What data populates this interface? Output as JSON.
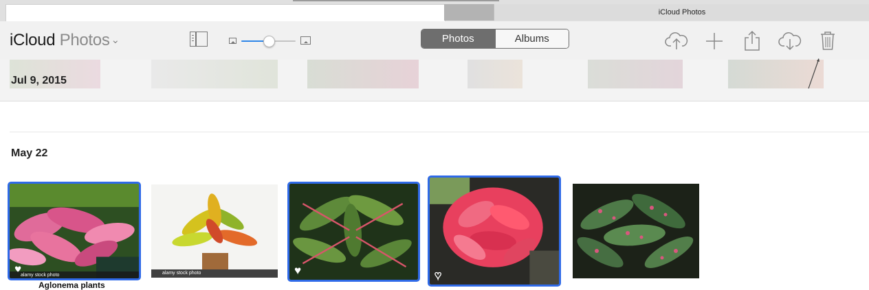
{
  "browser": {
    "tab_title": "iCloud Photos"
  },
  "app": {
    "brand_name": "iCloud",
    "section_name": "Photos",
    "section_chevron": "chevron-down-icon"
  },
  "toolbar": {
    "zoom_level": 0.5,
    "segmented": {
      "photos_label": "Photos",
      "albums_label": "Albums",
      "selected": "Photos"
    },
    "icons": [
      "sidebar-toggle-icon",
      "upload-icon",
      "add-icon",
      "share-icon",
      "download-icon",
      "trash-icon"
    ]
  },
  "sections": [
    {
      "title": "Jul 9, 2015"
    },
    {
      "title": "May 22"
    }
  ],
  "photos": [
    {
      "selected": true,
      "favorite": true,
      "watermark": "alamy stock photo",
      "caption": "Aglonema plants"
    },
    {
      "selected": false,
      "favorite": false,
      "watermark": "alamy stock photo"
    },
    {
      "selected": true,
      "favorite": true
    },
    {
      "selected": true,
      "favorite": false
    },
    {
      "selected": false,
      "favorite": false
    }
  ],
  "colors": {
    "selection_blue": "#2f6ae8",
    "slider_blue": "#2e86e8",
    "segment_active": "#6e6e6e"
  }
}
